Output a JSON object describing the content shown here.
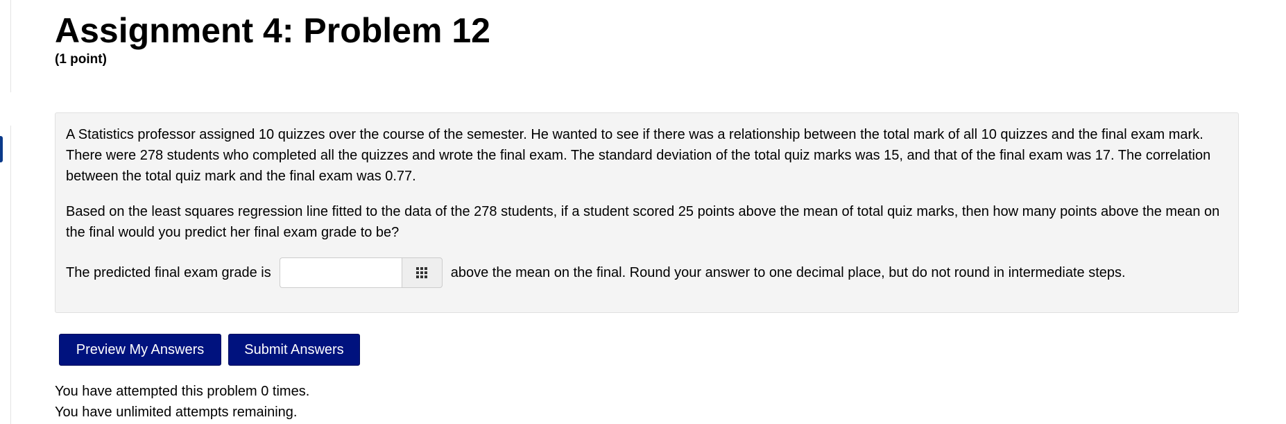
{
  "header": {
    "title": "Assignment 4: Problem 12",
    "points": "(1 point)"
  },
  "problem": {
    "paragraph1": "A Statistics professor assigned 10 quizzes over the course of the semester. He wanted to see if there was a relationship between the total mark of all 10 quizzes and the final exam mark. There were 278 students who completed all the quizzes and wrote the final exam. The standard deviation of the total quiz marks was 15, and that of the final exam was 17. The correlation between the total quiz mark and the final exam was 0.77.",
    "paragraph2": "Based on the least squares regression line fitted to the data of the 278 students, if a student scored 25 points above the mean of total quiz marks, then how many points above the mean on the final would you predict her final exam grade to be?",
    "answer_prefix": "The predicted final exam grade is",
    "answer_value": "",
    "answer_placeholder": "",
    "answer_suffix": "above the mean on the final. Round your answer to one decimal place, but do not round in intermediate steps.",
    "palette_icon": "grid-icon"
  },
  "actions": {
    "preview_label": "Preview My Answers",
    "submit_label": "Submit Answers"
  },
  "status": {
    "attempted": "You have attempted this problem 0 times.",
    "remaining": "You have unlimited attempts remaining."
  },
  "colors": {
    "button_bg": "#00127e",
    "box_bg": "#f4f4f4",
    "rail_tab": "#0b3a8a"
  }
}
